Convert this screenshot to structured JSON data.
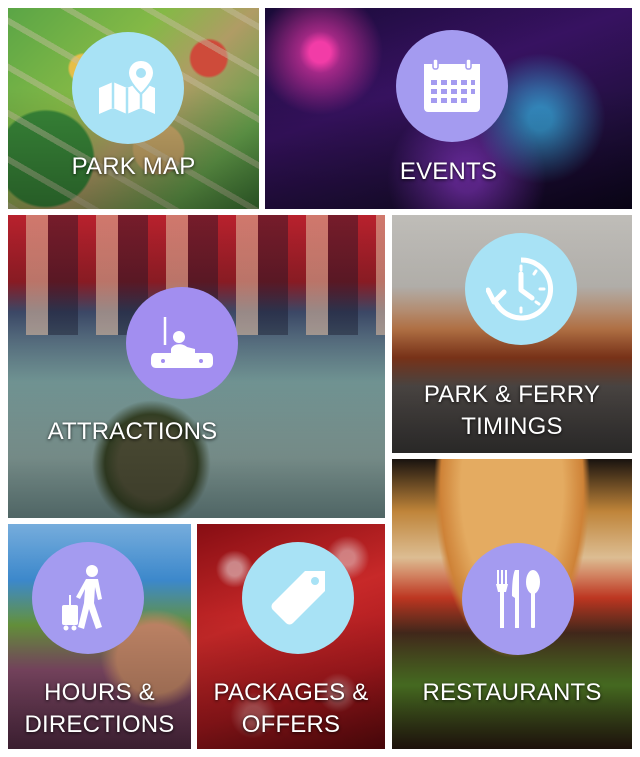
{
  "tiles": {
    "park_map": {
      "label": "PARK MAP",
      "icon": "map-pin-icon",
      "badge_color": "#a8e2f5"
    },
    "events": {
      "label": "EVENTS",
      "icon": "calendar-icon",
      "badge_color": "#a49bf0"
    },
    "attractions": {
      "label": "ATTRACTIONS",
      "icon": "bumper-car-icon",
      "badge_color": "#a28ef0"
    },
    "park_ferry": {
      "label_line1": "PARK & FERRY",
      "label_line2": "TIMINGS",
      "icon": "clock-icon",
      "badge_color": "#a8e2f5"
    },
    "hours": {
      "label_line1": "HOURS &",
      "label_line2": "DIRECTIONS",
      "icon": "traveler-icon",
      "badge_color": "#a49bf0"
    },
    "packages": {
      "label_line1": "PACKAGES &",
      "label_line2": "OFFERS",
      "icon": "price-tag-icon",
      "badge_color": "#a8e2f5"
    },
    "restaurants": {
      "label": "RESTAURANTS",
      "icon": "cutlery-icon",
      "badge_color": "#a49bf0"
    }
  }
}
